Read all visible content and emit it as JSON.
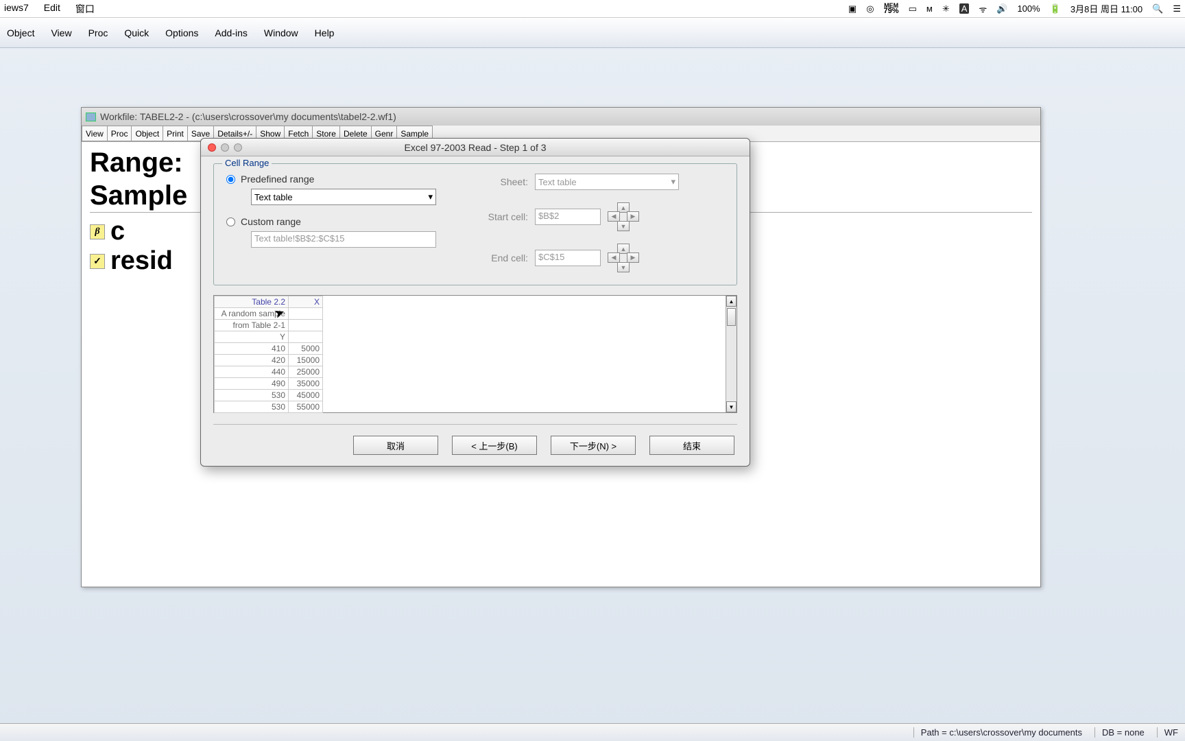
{
  "mac_menubar": {
    "app_name": "iews7",
    "items": [
      "Edit",
      "窗口"
    ],
    "mem_label": "MEM",
    "mem_pct": "79%",
    "battery": "100%",
    "datetime": "3月8日 周日 11:00"
  },
  "app_menubar": [
    "Object",
    "View",
    "Proc",
    "Quick",
    "Options",
    "Add-ins",
    "Window",
    "Help"
  ],
  "workfile": {
    "title": "Workfile: TABEL2-2 - (c:\\users\\crossover\\my documents\\tabel2-2.wf1)",
    "toolbar": [
      "View",
      "Proc",
      "Object",
      "Print",
      "Save",
      "Details+/-",
      "Show",
      "Fetch",
      "Store",
      "Delete",
      "Genr",
      "Sample"
    ],
    "range_label": "Range:",
    "sample_label": "Sample",
    "items": [
      {
        "icon": "beta",
        "name": "c"
      },
      {
        "icon": "check",
        "name": "resid"
      }
    ]
  },
  "dialog": {
    "title": "Excel 97-2003 Read - Step 1 of 3",
    "group_legend": "Cell Range",
    "predefined_label": "Predefined range",
    "predefined_value": "Text table",
    "custom_label": "Custom range",
    "custom_value": "Text table!$B$2:$C$15",
    "sheet_label": "Sheet:",
    "sheet_value": "Text table",
    "start_label": "Start cell:",
    "start_value": "$B$2",
    "end_label": "End cell:",
    "end_value": "$C$15",
    "preview_header1": "Table 2.2",
    "preview_header2": "X",
    "preview_sub1": "A random sample",
    "preview_sub2": "from Table 2-1",
    "preview_sub3": "Y",
    "rows": [
      {
        "c1": "410",
        "c2": "5000"
      },
      {
        "c1": "420",
        "c2": "15000"
      },
      {
        "c1": "440",
        "c2": "25000"
      },
      {
        "c1": "490",
        "c2": "35000"
      },
      {
        "c1": "530",
        "c2": "45000"
      },
      {
        "c1": "530",
        "c2": "55000"
      }
    ],
    "buttons": {
      "cancel": "取消",
      "back": "< 上一步(B)",
      "next": "下一步(N) >",
      "finish": "结束"
    }
  },
  "statusbar": {
    "path": "Path = c:\\users\\crossover\\my documents",
    "db": "DB = none",
    "wf": "WF"
  }
}
